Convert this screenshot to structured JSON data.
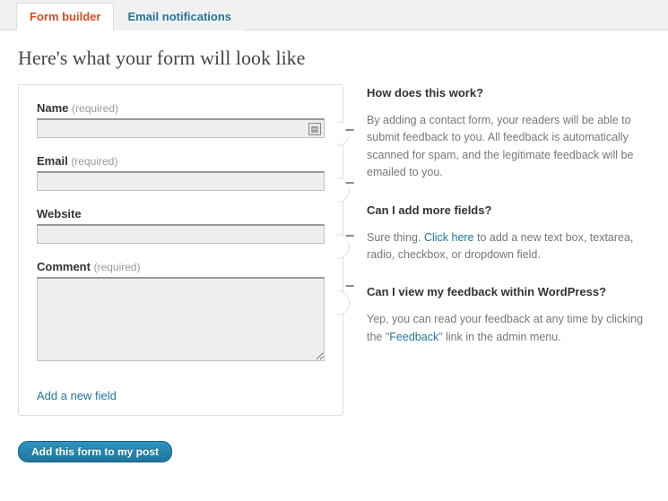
{
  "tabs": {
    "builder": "Form builder",
    "email": "Email notifications"
  },
  "page_title": "Here's what your form will look like",
  "required_suffix": "(required)",
  "fields": {
    "name": {
      "label": "Name",
      "required": true
    },
    "email": {
      "label": "Email",
      "required": true
    },
    "website": {
      "label": "Website",
      "required": false
    },
    "comment": {
      "label": "Comment",
      "required": true
    }
  },
  "add_field": "Add a new field",
  "help": {
    "how": {
      "title": "How does this work?",
      "body": "By adding a contact form, your readers will be able to submit feedback to you. All feedback is automatically scanned for spam, and the legitimate feedback will be emailed to you."
    },
    "more": {
      "title": "Can I add more fields?",
      "pre": "Sure thing. ",
      "link": "Click here",
      "post": " to add a new text box, textarea, radio, checkbox, or dropdown field."
    },
    "view": {
      "title": "Can I view my feedback within WordPress?",
      "pre": "Yep, you can read your feedback at any time by clicking the \"",
      "link": "Feedback",
      "post": "\" link in the admin menu."
    }
  },
  "submit": "Add this form to my post",
  "minus": "−"
}
